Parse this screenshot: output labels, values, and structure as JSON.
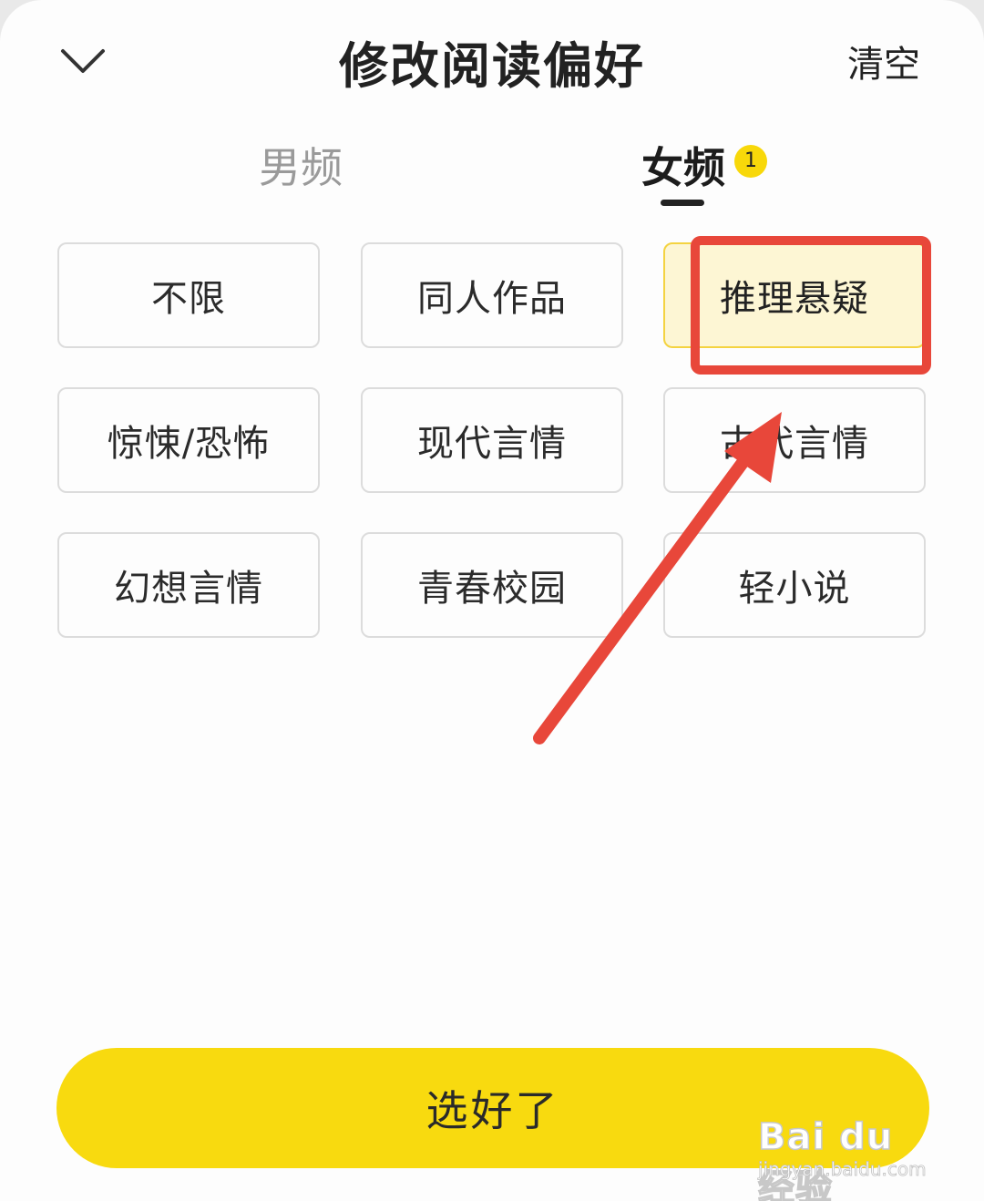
{
  "header": {
    "title": "修改阅读偏好",
    "clear_label": "清空",
    "close_icon": "chevron-down-icon"
  },
  "tabs": [
    {
      "label": "男频",
      "active": false
    },
    {
      "label": "女频",
      "active": true,
      "badge": "1"
    }
  ],
  "genres": [
    {
      "label": "不限",
      "selected": false
    },
    {
      "label": "同人作品",
      "selected": false
    },
    {
      "label": "推理悬疑",
      "selected": true
    },
    {
      "label": "惊悚/恐怖",
      "selected": false
    },
    {
      "label": "现代言情",
      "selected": false
    },
    {
      "label": "古代言情",
      "selected": false
    },
    {
      "label": "幻想言情",
      "selected": false
    },
    {
      "label": "青春校园",
      "selected": false
    },
    {
      "label": "轻小说",
      "selected": false
    }
  ],
  "confirm_label": "选好了",
  "colors": {
    "accent": "#f8da0f",
    "selected_bg": "#fdf6d4",
    "annotation_red": "#e8473a"
  },
  "watermark": {
    "brand": "Bai du 经验",
    "url": "jingyan.baidu.com"
  }
}
